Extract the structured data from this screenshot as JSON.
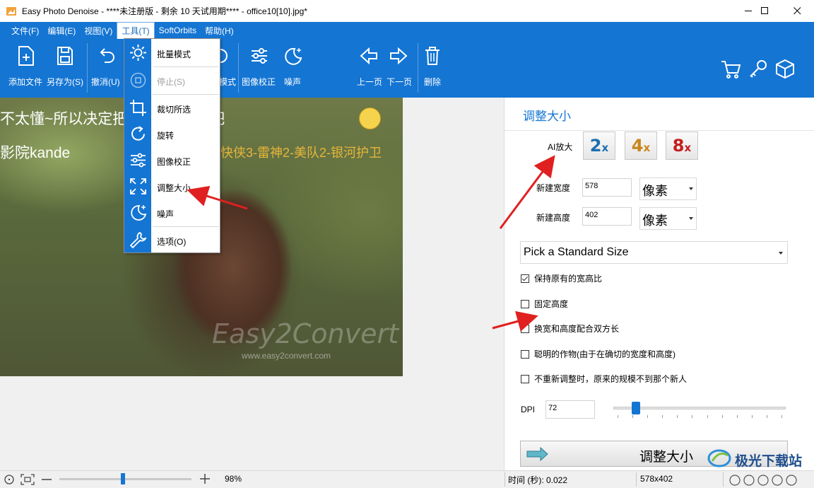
{
  "window": {
    "title": "Easy Photo Denoise - ****未注册版 - 剩余 10 天试用期**** - office10[10].jpg*",
    "minimize_glyph": "—",
    "maximize_glyph": "☐",
    "close_glyph": "✕"
  },
  "menubar": [
    "文件(F)",
    "编辑(E)",
    "视图(V)",
    "工具(T)",
    "SoftOrbits",
    "帮助(H)"
  ],
  "toolbar": {
    "add_file": "添加文件",
    "save_as": "另存为(S)",
    "undo": "撤消(U)",
    "batch_mode_partial": "模式",
    "image_correction": "图像校正",
    "noise": "噪声",
    "prev_page": "上一页",
    "next_page": "下一页",
    "delete": "删除"
  },
  "tools_menu": {
    "items": [
      {
        "label": "批量模式",
        "icon": "gear-icon",
        "disabled": false
      },
      {
        "label": "停止(S)",
        "icon": "stop-icon",
        "disabled": true
      },
      {
        "label": "裁切所选",
        "icon": "crop-icon",
        "disabled": false
      },
      {
        "label": "旋转",
        "icon": "rotate-icon",
        "disabled": false
      },
      {
        "label": "图像校正",
        "icon": "sliders-icon",
        "disabled": false
      },
      {
        "label": "调整大小",
        "icon": "resize-icon",
        "disabled": false
      },
      {
        "label": "噪声",
        "icon": "moon-sparkle-icon",
        "disabled": false
      },
      {
        "label": "选项(O)",
        "icon": "wrench-icon",
        "disabled": false
      }
    ]
  },
  "photo": {
    "caption1": "不太懂~所以决定把",
    "caption1_tail": "吧",
    "caption2": "影院kande",
    "caption2_tail": "快侠3-雷神2-美队2-银河护卫",
    "watermark": "Easy2Convert",
    "watermark_url": "www.easy2convert.com"
  },
  "panel": {
    "title": "调整大小",
    "ai_label": "AI放大",
    "ai_buttons": [
      {
        "num": "2",
        "x": "x",
        "color": "#1d6fae"
      },
      {
        "num": "4",
        "x": "x",
        "color": "#c8861e"
      },
      {
        "num": "8",
        "x": "x",
        "color": "#c41e1e"
      }
    ],
    "new_width_label": "新建宽度",
    "new_width_value": "578",
    "new_height_label": "新建高度",
    "new_height_value": "402",
    "unit": "像素",
    "standard_size": "Pick a Standard Size",
    "checkboxes": [
      {
        "label": "保持原有的宽高比",
        "checked": true
      },
      {
        "label": "固定高度",
        "checked": false
      },
      {
        "label": "换宽和高度配合双方长",
        "checked": false
      },
      {
        "label": "聪明的作物(由于在确切的宽度和高度)",
        "checked": false
      },
      {
        "label": "不重新调整时，原来的规模不到那个新人",
        "checked": false
      }
    ],
    "dpi_label": "DPI",
    "dpi_value": "72",
    "dpi_slider_fraction": 0.13,
    "resize_button": "调整大小"
  },
  "statusbar": {
    "zoom": "98%",
    "zoom_slider_fraction": 0.48,
    "time_label": "时间 (秒): 0.022",
    "dimensions": "578x402"
  },
  "brand_watermark": "极光下载站",
  "colors": {
    "accent": "#1475d3",
    "annotation_red": "#e02020"
  }
}
